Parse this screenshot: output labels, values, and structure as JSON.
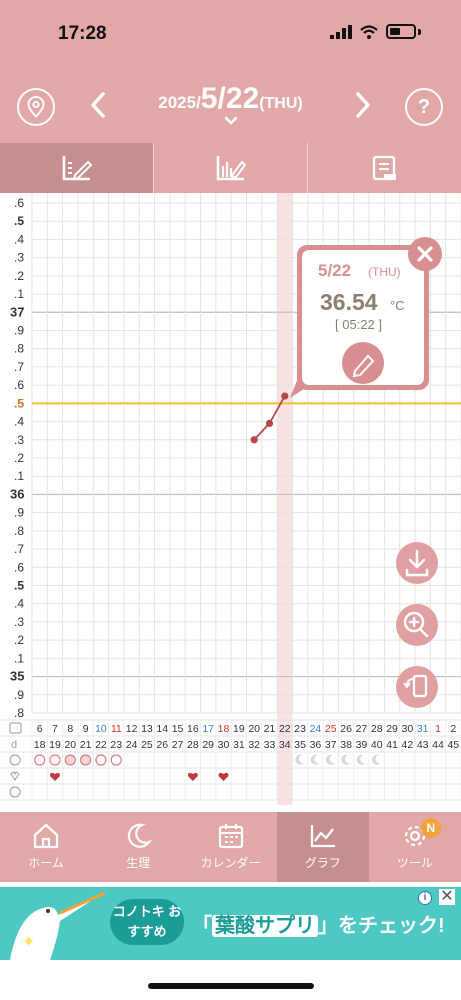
{
  "status": {
    "time": "17:28"
  },
  "header": {
    "year": "2025/",
    "date": "5/22",
    "dow": "(THU)"
  },
  "tabs": [
    {
      "icon": "graph-edit-icon"
    },
    {
      "icon": "bar-edit-icon"
    },
    {
      "icon": "note-icon"
    }
  ],
  "popup": {
    "date": "5/22",
    "dow": "(THU)",
    "temp": "36.54",
    "unit": "°C",
    "time": "[ 05:22 ]"
  },
  "graph": {
    "y_labels": [
      ".6",
      ".5",
      ".4",
      ".3",
      ".2",
      ".1",
      "37",
      ".9",
      ".8",
      ".7",
      ".6",
      ".5",
      ".4",
      ".3",
      ".2",
      ".1",
      "36",
      ".9",
      ".8",
      ".7",
      ".6",
      ".5",
      ".4",
      ".3",
      ".2",
      ".1",
      "35",
      ".9",
      ".8"
    ],
    "days": [
      "6",
      "7",
      "8",
      "9",
      "10",
      "11",
      "12",
      "13",
      "14",
      "15",
      "16",
      "17",
      "18",
      "19",
      "20",
      "21",
      "22",
      "23",
      "24",
      "25",
      "26",
      "27",
      "28",
      "29",
      "30",
      "31",
      "1",
      "2"
    ],
    "day_colors": [
      "#333",
      "#333",
      "#333",
      "#333",
      "#3a7fd5",
      "#d93030",
      "#333",
      "#333",
      "#333",
      "#333",
      "#333",
      "#3a7fd5",
      "#d93030",
      "#333",
      "#333",
      "#333",
      "#333",
      "#333",
      "#3a7fd5",
      "#d93030",
      "#333",
      "#333",
      "#333",
      "#333",
      "#333",
      "#3a7fd5",
      "#d93030",
      "#333"
    ],
    "cycle_days": [
      "18",
      "19",
      "20",
      "21",
      "22",
      "23",
      "24",
      "25",
      "26",
      "27",
      "28",
      "29",
      "30",
      "31",
      "32",
      "33",
      "34",
      "35",
      "36",
      "37",
      "38",
      "39",
      "40",
      "41",
      "42",
      "43",
      "44",
      "45"
    ],
    "cycle_label": "d",
    "highlight_index": 16,
    "baseline": 36.5,
    "y_top": 37.6,
    "y_bottom": 34.8
  },
  "chart_data": {
    "type": "line",
    "x": [
      "5/20",
      "5/21",
      "5/22"
    ],
    "values": [
      36.3,
      36.39,
      36.54
    ],
    "ylim": [
      34.8,
      37.6
    ],
    "baseline": 36.5
  },
  "nav": [
    {
      "label": "ホーム",
      "icon": "home-icon"
    },
    {
      "label": "生理",
      "icon": "moon-icon"
    },
    {
      "label": "カレンダー",
      "icon": "calendar-icon"
    },
    {
      "label": "グラフ",
      "icon": "graph-icon"
    },
    {
      "label": "ツール",
      "icon": "gear-icon",
      "badge": "N"
    }
  ],
  "ad": {
    "tag": "コノトキ おすすめ",
    "pre": "「",
    "highlight": "葉酸サプリ",
    "post": "」をチェック!"
  }
}
